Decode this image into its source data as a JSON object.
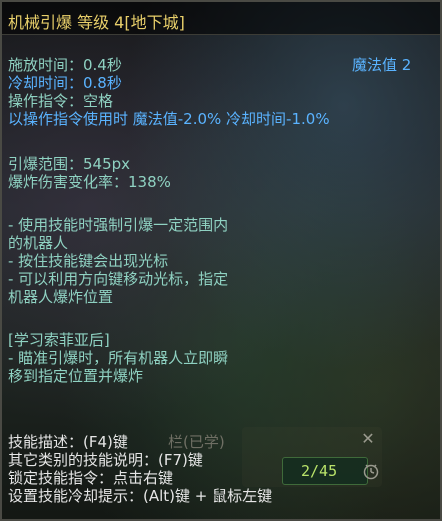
{
  "title": "机械引爆 等级 4[地下城]",
  "stats": {
    "cast_time": "施放时间：0.4秒",
    "cooldown": "冷却时间：0.8秒",
    "mana_cost": "魔法值 2",
    "command": "操作指令：空格",
    "command_bonus": "以操作指令使用时 魔法值-2.0% 冷却时间-1.0%"
  },
  "params": {
    "range": "引爆范围：545px",
    "damage_rate": "爆炸伤害变化率：138%"
  },
  "description": [
    "- 使用技能时强制引爆一定范围内",
    "的机器人",
    "- 按住技能键会出现光标",
    "- 可以利用方向键移动光标，指定",
    "机器人爆炸位置"
  ],
  "learn_section": {
    "header": "[学习索菲亚后]",
    "lines": [
      "- 瞄准引爆时，所有机器人立即瞬",
      "移到指定位置并爆炸"
    ]
  },
  "footer": {
    "skill_desc": "技能描述：(F4)键",
    "skill_desc_overlay": "栏(已学)",
    "other_desc": "其它类别的技能说明：(F7)键",
    "lock_skill": "锁定技能指令：点击右键",
    "cooldown_hint": "设置技能冷却提示：(Alt)键 + 鼠标左键"
  },
  "cooldown_counter": "2/45",
  "icons": {
    "close": "close-icon",
    "clock": "clock-icon"
  },
  "colors": {
    "title": "#e8cf6a",
    "label": "#8fd2c2",
    "blue": "#5ab3ff",
    "text": "#e6e6e6",
    "counter": "#b9e36a"
  }
}
